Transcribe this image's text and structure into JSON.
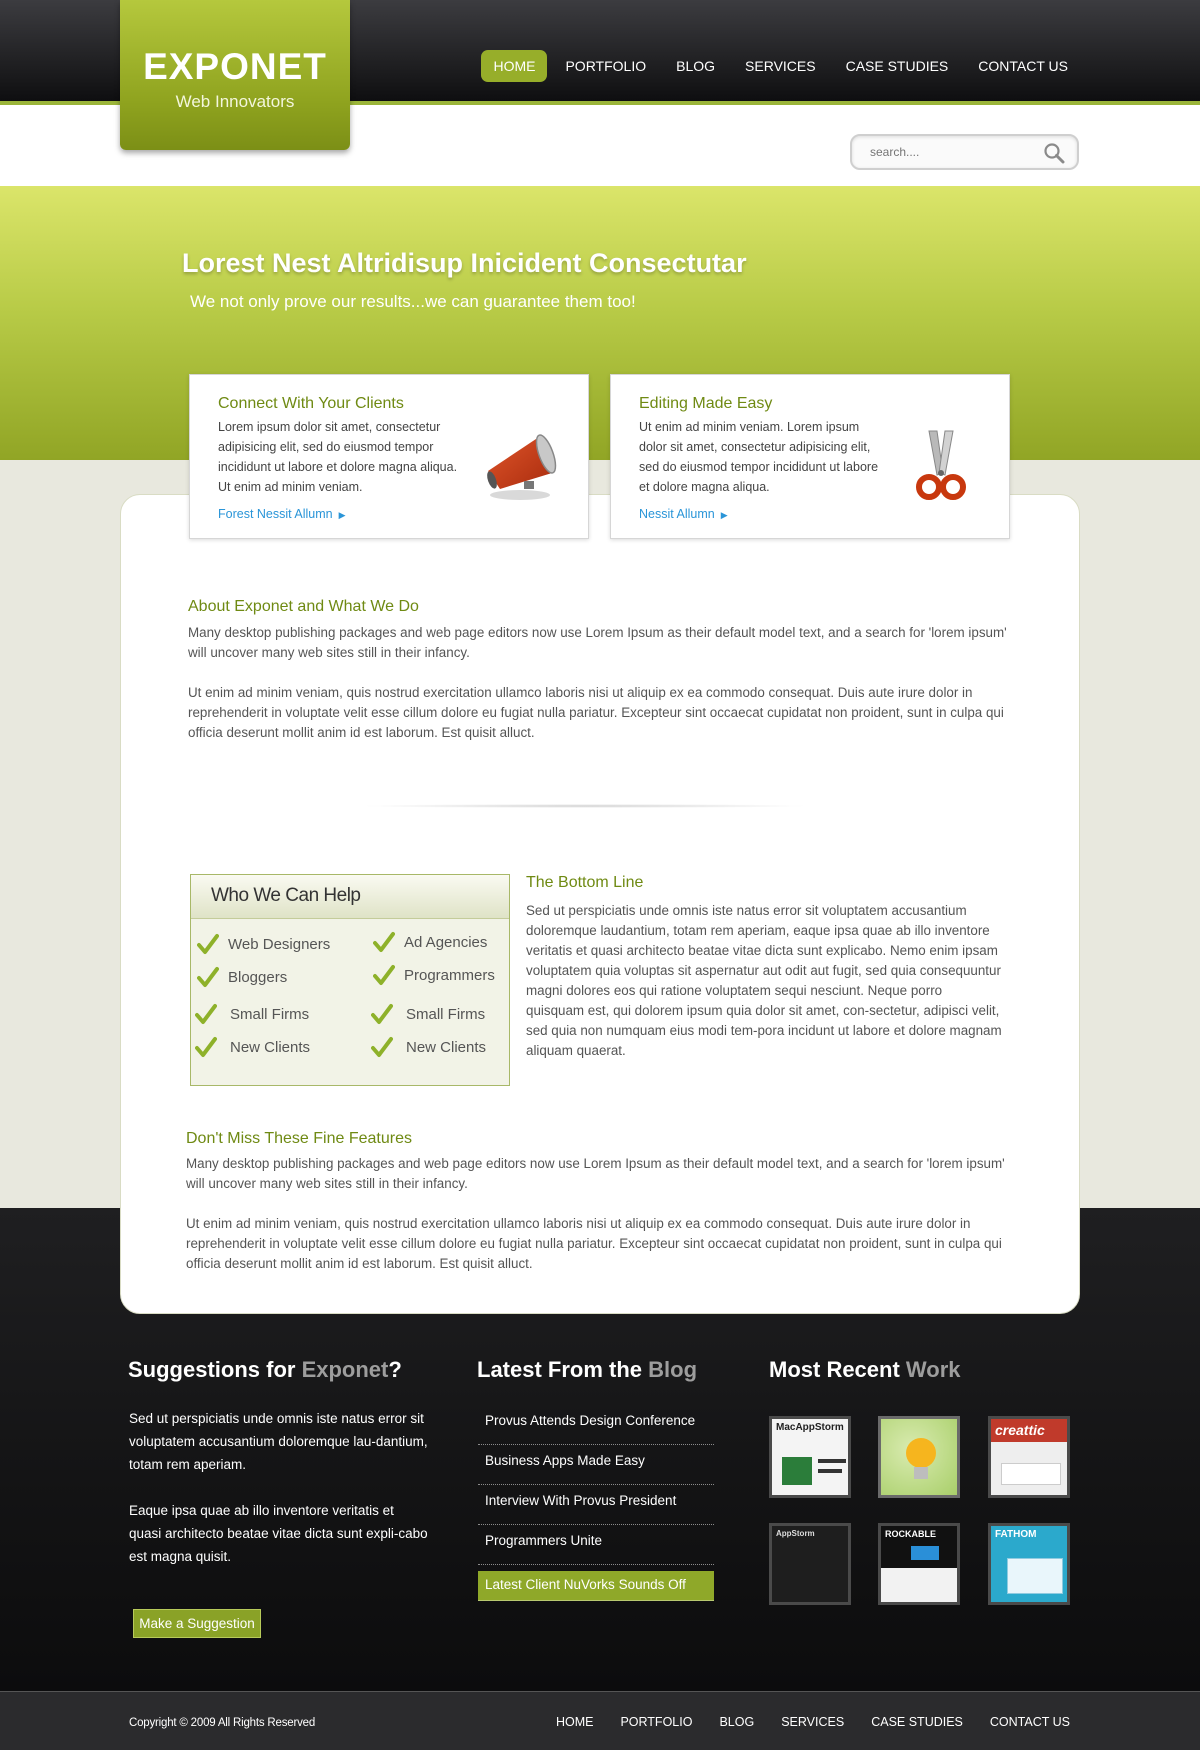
{
  "header": {
    "logo_title": "EXPONET",
    "logo_tagline": "Web Innovators",
    "nav": [
      {
        "label": "HOME",
        "active": true
      },
      {
        "label": "PORTFOLIO"
      },
      {
        "label": "BLOG"
      },
      {
        "label": "SERVICES"
      },
      {
        "label": "CASE STUDIES"
      },
      {
        "label": "CONTACT US"
      }
    ],
    "search_placeholder": "search...."
  },
  "hero": {
    "title": "Lorest Nest Altridisup Inicident Consectutar",
    "subtitle": "We not only prove our results...we can guarantee them too!"
  },
  "features": [
    {
      "title": "Connect With Your Clients",
      "text": "Lorem ipsum dolor sit amet, consectetur adipisicing elit, sed do eiusmod tempor incididunt ut labore et dolore magna aliqua. Ut enim ad minim veniam.",
      "link": "Forest Nessit Allumn",
      "icon": "megaphone-icon"
    },
    {
      "title": "Editing Made Easy",
      "text": "Ut enim ad minim veniam. Lorem ipsum dolor sit amet, consectetur adipisicing elit, sed do eiusmod tempor incididunt ut labore et dolore magna aliqua.",
      "link": "Nessit Allumn",
      "icon": "scissors-icon"
    }
  ],
  "about": {
    "title": "About Exponet and What We Do",
    "p1": "Many desktop publishing packages and web page editors now use Lorem Ipsum as their default model text, and a search for 'lorem ipsum' will uncover many web sites still in their infancy.",
    "p2": "Ut enim ad minim veniam, quis nostrud exercitation ullamco laboris nisi ut aliquip ex ea commodo consequat. Duis aute irure dolor in reprehenderit in voluptate velit esse cillum dolore eu fugiat nulla pariatur. Excepteur sint occaecat cupidatat non proident, sunt in culpa qui officia deserunt mollit anim id est laborum. Est quisit alluct."
  },
  "help": {
    "title": "Who We Can Help",
    "items": [
      "Web Designers",
      "Ad Agencies",
      "Bloggers",
      "Programmers",
      "Small Firms",
      "Small Firms",
      "New Clients",
      "New Clients"
    ]
  },
  "bottom_line": {
    "title": "The Bottom Line",
    "text": "Sed ut perspiciatis unde omnis iste natus error sit voluptatem accusantium doloremque laudantium, totam rem aperiam, eaque ipsa quae ab illo inventore veritatis et quasi architecto beatae vitae dicta sunt explicabo. Nemo enim ipsam voluptatem quia voluptas sit aspernatur aut odit aut fugit, sed quia consequuntur magni dolores eos qui ratione voluptatem sequi nesciunt. Neque porro quisquam est, qui dolorem ipsum quia dolor sit amet, con-sectetur, adipisci velit, sed quia non numquam eius modi tem-pora incidunt ut labore et dolore magnam aliquam quaerat."
  },
  "fine_features": {
    "title": "Don't Miss These Fine Features",
    "p1": "Many desktop publishing packages and web page editors now use Lorem Ipsum as their default model text, and a search for 'lorem ipsum' will uncover many web sites still in their infancy.",
    "p2": "Ut enim ad minim veniam, quis nostrud exercitation ullamco laboris nisi ut aliquip ex ea commodo consequat. Duis aute irure dolor in reprehenderit in voluptate velit esse cillum dolore eu fugiat nulla pariatur. Excepteur sint occaecat cupidatat non proident, sunt in culpa qui officia deserunt mollit anim id est laborum. Est quisit alluct."
  },
  "footer": {
    "suggestions": {
      "title_main": "Suggestions for ",
      "title_dim": "Exponet",
      "title_end": "?",
      "p1": "Sed ut perspiciatis unde omnis iste natus error sit voluptatem accusantium doloremque lau-dantium, totam rem aperiam.",
      "p2": "Eaque ipsa quae ab illo inventore veritatis et quasi architecto beatae vitae dicta sunt expli-cabo est magna quisit.",
      "button": "Make a Suggestion"
    },
    "blog": {
      "title_main": "Latest From the ",
      "title_dim": "Blog",
      "items": [
        "Provus Attends Design Conference",
        "Business Apps Made Easy",
        "Interview With Provus President",
        "Programmers Unite",
        "Latest Client NuVorks Sounds Off"
      ]
    },
    "work": {
      "title_main": "Most Recent ",
      "title_dim": "Work",
      "thumbs": [
        {
          "label": "MacAppStorm",
          "color": "#f4f4f4",
          "text_color": "#222"
        },
        {
          "label": "",
          "color": "#a9cf6a",
          "text_color": "#fff"
        },
        {
          "label": "creattic",
          "color": "#c03a2b",
          "text_color": "#fff"
        },
        {
          "label": "AppStorm",
          "color": "#1e1e1e",
          "text_color": "#ddd"
        },
        {
          "label": "ROCKABLE",
          "color": "#111111",
          "text_color": "#fff"
        },
        {
          "label": "FATHOM",
          "color": "#2ba9cc",
          "text_color": "#fff"
        }
      ]
    },
    "copyright": "Copyright © 2009  All Rights Reserved",
    "nav": [
      "HOME",
      "PORTFOLIO",
      "BLOG",
      "SERVICES",
      "CASE STUDIES",
      "CONTACT US"
    ]
  },
  "colors": {
    "accent": "#97ae2a",
    "heading": "#6f8a13",
    "link": "#2a95d8"
  }
}
